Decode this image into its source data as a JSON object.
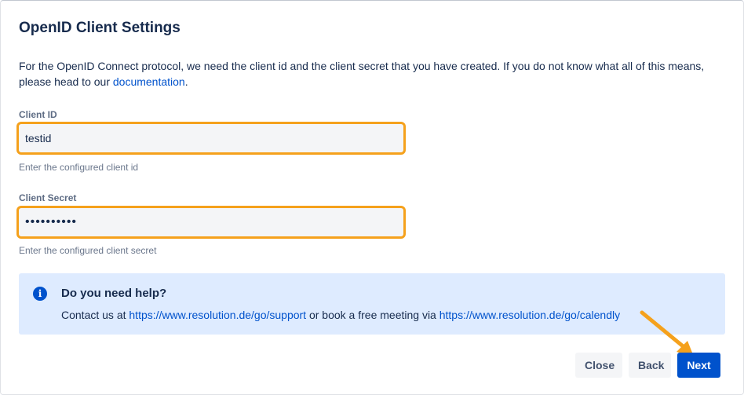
{
  "page": {
    "title": "OpenID Client Settings",
    "intro_text": "For the OpenID Connect protocol, we need the client id and the client secret that you have created. If you do not know what all of this means, please head to our ",
    "intro_link": "documentation",
    "intro_end": "."
  },
  "fields": {
    "client_id": {
      "label": "Client ID",
      "value": "testid",
      "help": "Enter the configured client id"
    },
    "client_secret": {
      "label": "Client Secret",
      "value": "••••••••••",
      "help": "Enter the configured client secret"
    }
  },
  "help_panel": {
    "icon": "info-icon",
    "icon_glyph": "i",
    "title": "Do you need help?",
    "text_before": "Contact us at ",
    "support_link": "https://www.resolution.de/go/support",
    "text_middle": " or book a free meeting via ",
    "calendly_link": "https://www.resolution.de/go/calendly"
  },
  "buttons": {
    "close": "Close",
    "back": "Back",
    "next": "Next"
  },
  "colors": {
    "highlight": "#f5a11c",
    "primary": "#0052cc",
    "info_bg": "#deebff"
  }
}
